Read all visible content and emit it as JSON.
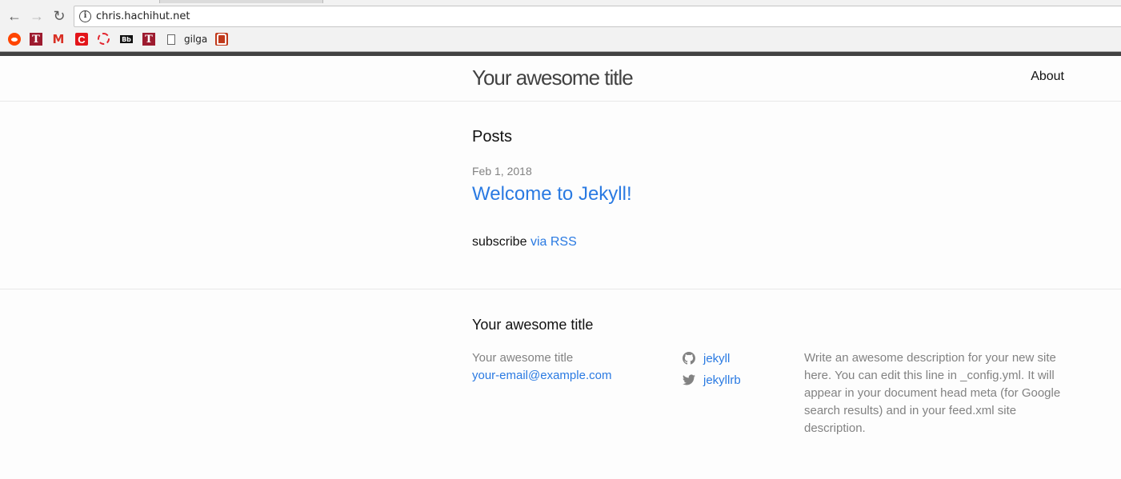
{
  "browser": {
    "url": "chris.hachihut.net",
    "bookmarks": [
      {
        "icon": "reddit-icon"
      },
      {
        "icon": "temple-t-icon",
        "glyph": "T"
      },
      {
        "icon": "gmail-icon",
        "glyph": "M"
      },
      {
        "icon": "c-logo-icon",
        "glyph": "C"
      },
      {
        "icon": "dashed-ring-icon"
      },
      {
        "icon": "blackboard-icon",
        "glyph": "Bb"
      },
      {
        "icon": "temple-t-icon",
        "glyph": "T"
      },
      {
        "icon": "page-icon",
        "label": "gilga"
      },
      {
        "icon": "bookmark-logo-icon"
      }
    ]
  },
  "site": {
    "title": "Your awesome title",
    "nav": {
      "about": "About"
    },
    "posts_heading": "Posts",
    "posts": [
      {
        "date": "Feb 1, 2018",
        "title": "Welcome to Jekyll!"
      }
    ],
    "rss": {
      "prefix": "subscribe",
      "link": "via RSS"
    }
  },
  "footer": {
    "heading": "Your awesome title",
    "name": "Your awesome title",
    "email": "your-email@example.com",
    "social": [
      {
        "icon": "github-icon",
        "label": "jekyll"
      },
      {
        "icon": "twitter-icon",
        "label": "jekyllrb"
      }
    ],
    "description": "Write an awesome description for your new site here. You can edit this line in _config.yml. It will appear in your document head meta (for Google search results) and in your feed.xml site description."
  },
  "colors": {
    "link": "#2a7ae2",
    "muted": "#828282",
    "title": "#424242"
  }
}
